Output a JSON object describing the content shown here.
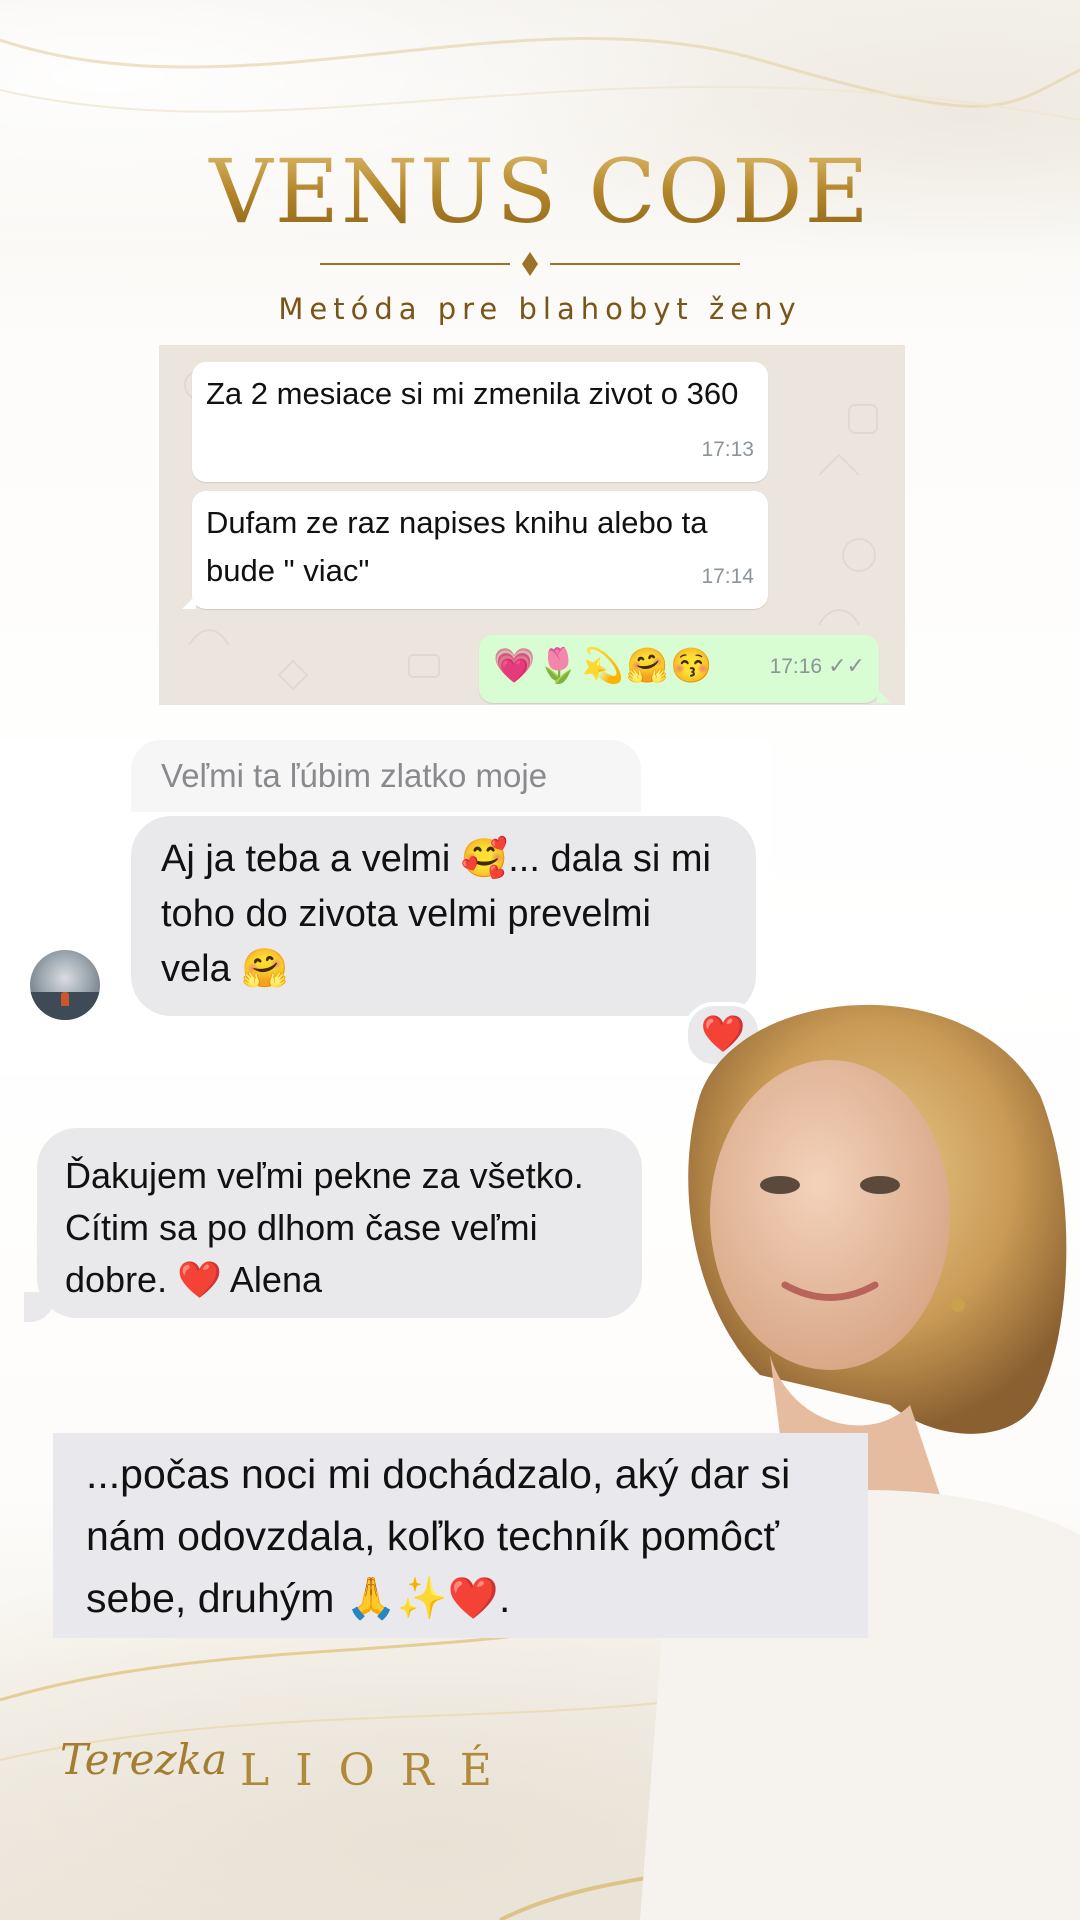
{
  "header": {
    "title": "VENUS CODE",
    "subtitle": "Metóda pre blahobyt ženy"
  },
  "whatsapp": {
    "messages": [
      {
        "text": "Za 2 mesiace si mi zmenila zivot o 360",
        "time": "17:13",
        "direction": "in"
      },
      {
        "text": "Dufam ze raz napises knihu alebo ta bude \" viac\"",
        "time": "17:14",
        "direction": "in"
      },
      {
        "text": "💗🌷💫🤗😚",
        "time": "17:16",
        "direction": "out",
        "status": "✓✓"
      }
    ]
  },
  "imessage_1": {
    "reply_to": "Veľmi ta ľúbim zlatko moje",
    "text": "Aj ja teba a velmi 🥰... dala si mi toho do zivota velmi prevelmi vela 🤗",
    "reaction": "❤️"
  },
  "imessage_2": {
    "text": "Ďakujem veľmi pekne za všetko. Cítim sa po dlhom čase veľmi dobre. ❤️ Alena"
  },
  "imessage_3": {
    "text": "...počas noci mi dochádzalo, aký dar si nám odovzdala, koľko techník pomôcť sebe, druhým 🙏✨❤️."
  },
  "signature": {
    "script": "Terezka",
    "name": "LIORÉ"
  },
  "colors": {
    "gold": "#b48a2d",
    "whatsapp_bg": "#ece5dd",
    "whatsapp_out": "#d9fdd3",
    "imessage_gray": "#e9e9eb"
  }
}
